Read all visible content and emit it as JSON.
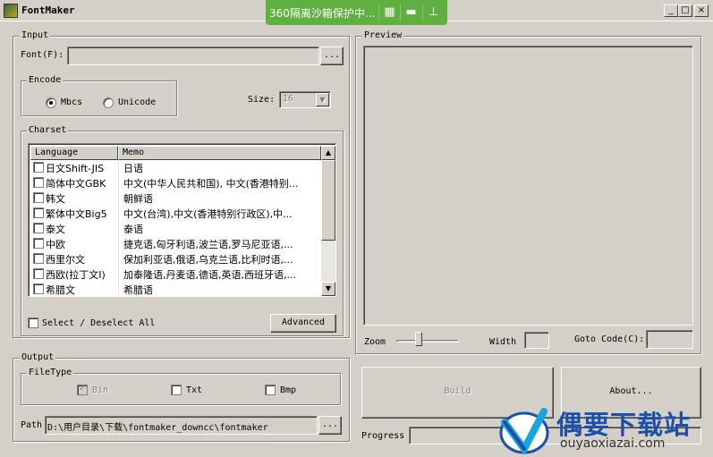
{
  "window": {
    "title": "FontMaker"
  },
  "sandbox": {
    "text": "360隔离沙箱保护中...",
    "icons": [
      "sandbox-icon",
      "folder-icon",
      "pin-icon"
    ]
  },
  "input": {
    "legend": "Input",
    "font_label": "Font(F):",
    "font_value": "",
    "browse_label": "...",
    "encode": {
      "legend": "Encode",
      "mbcs": "Mbcs",
      "unicode": "Unicode",
      "selected": "Mbcs"
    },
    "size_label": "Size:",
    "size_value": "16"
  },
  "charset": {
    "legend": "Charset",
    "columns": [
      "Language",
      "Memo"
    ],
    "rows": [
      {
        "language": "日文Shift-JIS",
        "memo": "日语"
      },
      {
        "language": "简体中文GBK",
        "memo": "中文(中华人民共和国), 中文(香港特别..."
      },
      {
        "language": "韩文",
        "memo": "朝鲜语"
      },
      {
        "language": "繁体中文Big5",
        "memo": "中文(台湾),中文(香港特别行政区),中..."
      },
      {
        "language": "泰文",
        "memo": "泰语"
      },
      {
        "language": "中欧",
        "memo": "捷克语,匈牙利语,波兰语,罗马尼亚语,..."
      },
      {
        "language": "西里尔文",
        "memo": "保加利亚语,俄语,乌克兰语,比利时语,..."
      },
      {
        "language": "西欧(拉丁文I)",
        "memo": "加泰隆语,丹麦语,德语,英语,西班牙语,..."
      },
      {
        "language": "希腊文",
        "memo": "希腊语"
      }
    ],
    "select_all_label": "Select / Deselect All",
    "advanced_label": "Advanced"
  },
  "output": {
    "legend": "Output",
    "filetype": {
      "legend": "FileType",
      "bin": "Bin",
      "txt": "Txt",
      "bmp": "Bmp"
    },
    "path_label": "Path",
    "path_value": "D:\\用户目录\\下载\\fontmaker_downcc\\fontmaker",
    "browse_label": "..."
  },
  "preview": {
    "legend": "Preview",
    "zoom_label": "Zoom",
    "width_label": "Width",
    "width_value": "",
    "goto_label": "Goto Code(C):",
    "goto_value": ""
  },
  "actions": {
    "build_label": "Build",
    "about_label": "About..."
  },
  "progress": {
    "label": "Progress"
  },
  "watermark": {
    "cn": "偶要下载站",
    "en": "ouyaoxiazai.com"
  }
}
